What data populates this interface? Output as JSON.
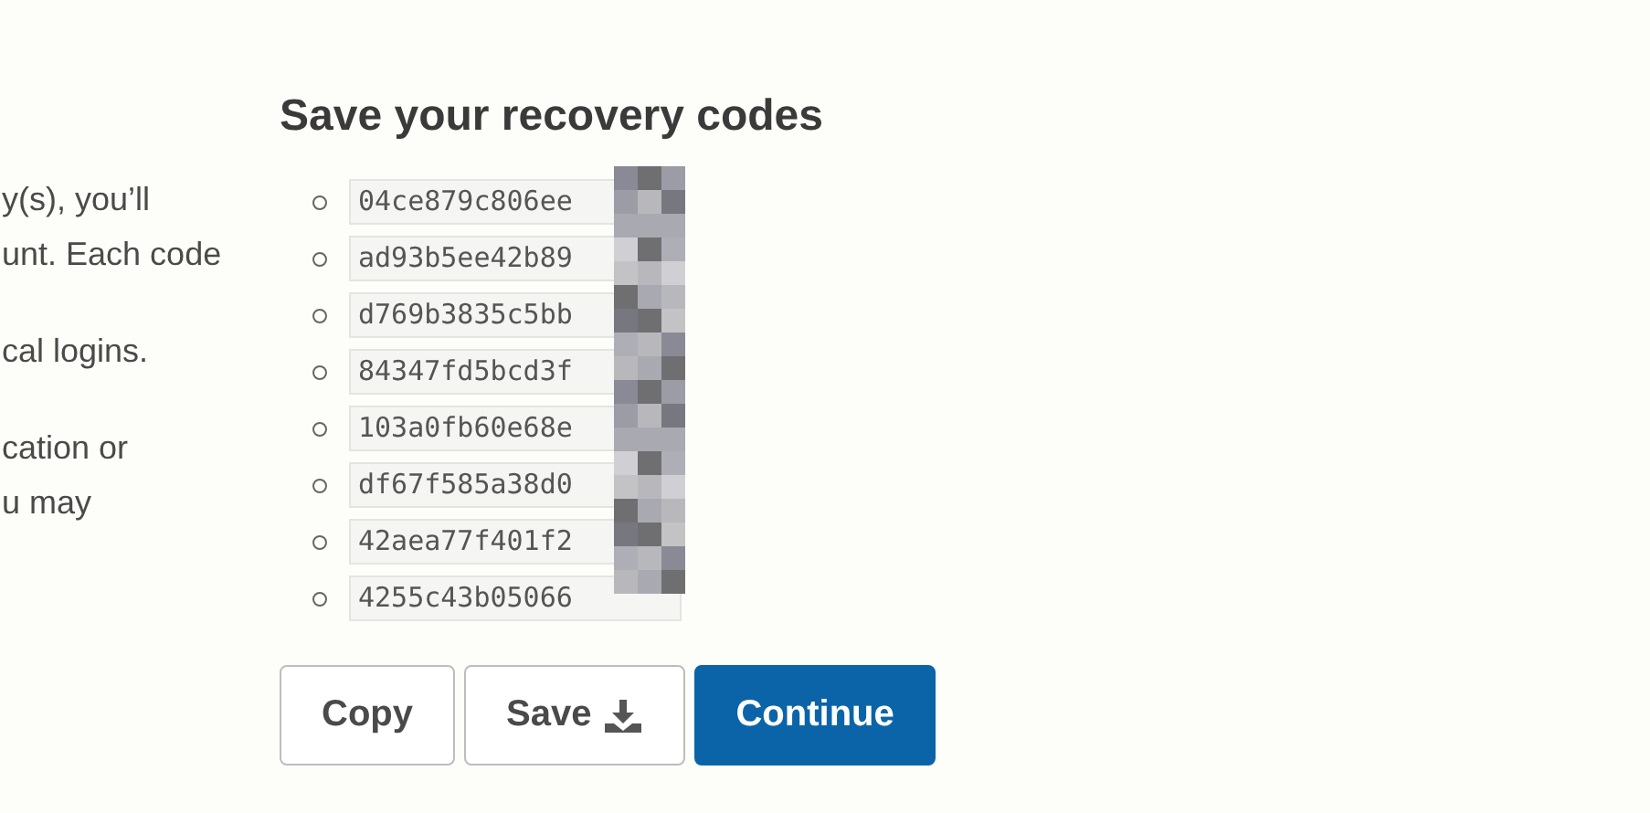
{
  "side_text": [
    {
      "lines": [
        "y(s), you’ll",
        "unt. Each code"
      ]
    },
    {
      "lines": [
        "cal logins."
      ]
    },
    {
      "lines": [
        "cation or",
        "u may"
      ]
    }
  ],
  "title": "Save your recovery codes",
  "codes": [
    "04ce879c806ee",
    "ad93b5ee42b89",
    "d769b3835c5bb",
    "84347fd5bcd3f",
    "103a0fb60e68e",
    "df67f585a38d0",
    "42aea77f401f2",
    "4255c43b05066"
  ],
  "buttons": [
    {
      "label": "Copy",
      "kind": "plain"
    },
    {
      "label": "Save",
      "kind": "download"
    },
    {
      "label": "Continue",
      "kind": "primary"
    }
  ]
}
